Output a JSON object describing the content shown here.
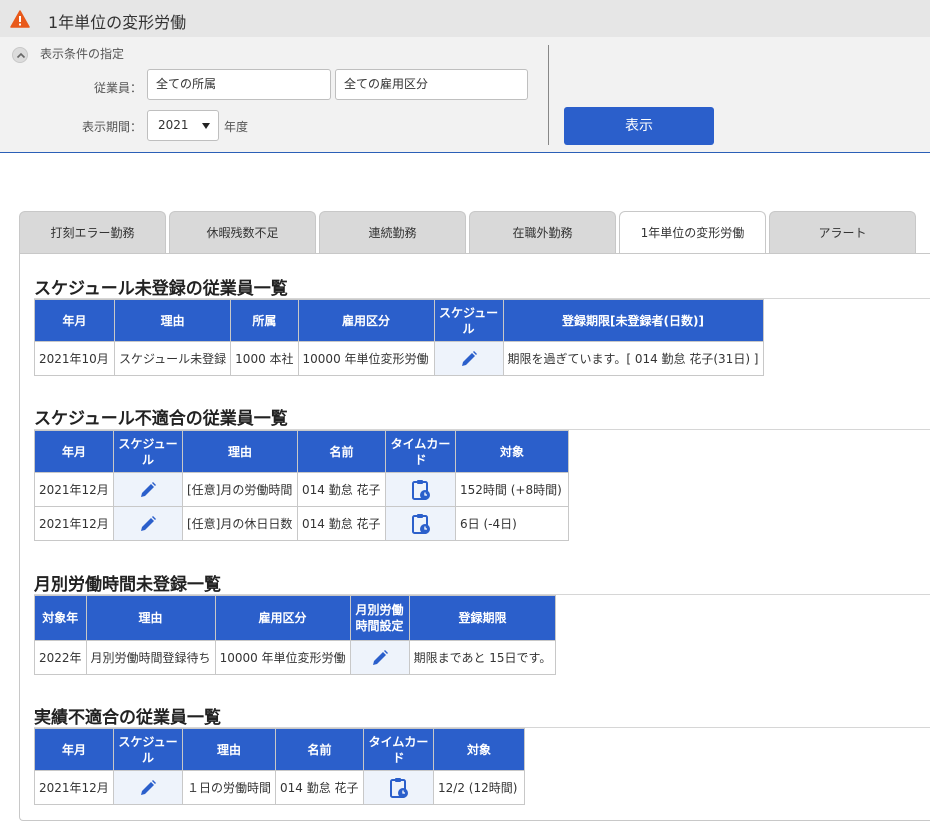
{
  "app": {
    "title": "1年単位の変形労働",
    "warning_icon": "warning-icon"
  },
  "conditions": {
    "title": "表示条件の指定",
    "employee_label": "従業員：",
    "department_value": "全ての所属",
    "employment_type_value": "全ての雇用区分",
    "period_label": "表示期間：",
    "year_value": "2021",
    "year_unit": "年度",
    "show_button": "表示"
  },
  "tabs": [
    {
      "label": "打刻エラー勤務"
    },
    {
      "label": "休暇残数不足"
    },
    {
      "label": "連続勤務"
    },
    {
      "label": "在職外勤務"
    },
    {
      "label": "1年単位の変形労働",
      "active": true
    },
    {
      "label": "アラート"
    }
  ],
  "sections": {
    "schedule_unregistered": {
      "title": "スケジュール未登録の従業員一覧",
      "headers": [
        "年月",
        "理由",
        "所属",
        "雇用区分",
        "スケジュール",
        "登録期限[未登録者(日数)]"
      ],
      "rows": [
        {
          "month": "2021年10月",
          "reason": "スケジュール未登録",
          "dept": "1000 本社",
          "type": "10000 年単位変形労働",
          "deadline": "期限を過ぎています。[ 014 勤怠 花子(31日) ]"
        }
      ]
    },
    "schedule_mismatch": {
      "title": "スケジュール不適合の従業員一覧",
      "headers": [
        "年月",
        "スケジュール",
        "理由",
        "名前",
        "タイムカード",
        "対象"
      ],
      "rows": [
        {
          "month": "2021年12月",
          "reason": "[任意]月の労働時間",
          "name": "014 勤怠 花子",
          "target": "152時間 (+8時間)"
        },
        {
          "month": "2021年12月",
          "reason": "[任意]月の休日日数",
          "name": "014 勤怠 花子",
          "target": "6日 (-4日)"
        }
      ]
    },
    "monthly_hours": {
      "title": "月別労働時間未登録一覧",
      "headers": [
        "対象年",
        "理由",
        "雇用区分",
        "月別労働\n時間設定",
        "登録期限"
      ],
      "header_line1": "月別労働",
      "header_line2": "時間設定",
      "rows": [
        {
          "year": "2022年",
          "reason": "月別労働時間登録待ち",
          "type": "10000 年単位変形労働",
          "deadline": "期限まであと 15日です。"
        }
      ]
    },
    "actual_mismatch": {
      "title": "実績不適合の従業員一覧",
      "headers": [
        "年月",
        "スケジュール",
        "理由",
        "名前",
        "タイムカード",
        "対象"
      ],
      "rows": [
        {
          "month": "2021年12月",
          "reason": "１日の労働時間",
          "name": "014 勤怠 花子",
          "target": "12/2 (12時間)"
        }
      ]
    }
  },
  "colors": {
    "accent": "#2b5fcb",
    "header_bg": "#e6e6e6",
    "icon_cell_bg": "#eef3fb",
    "warning": "#e8591a"
  }
}
